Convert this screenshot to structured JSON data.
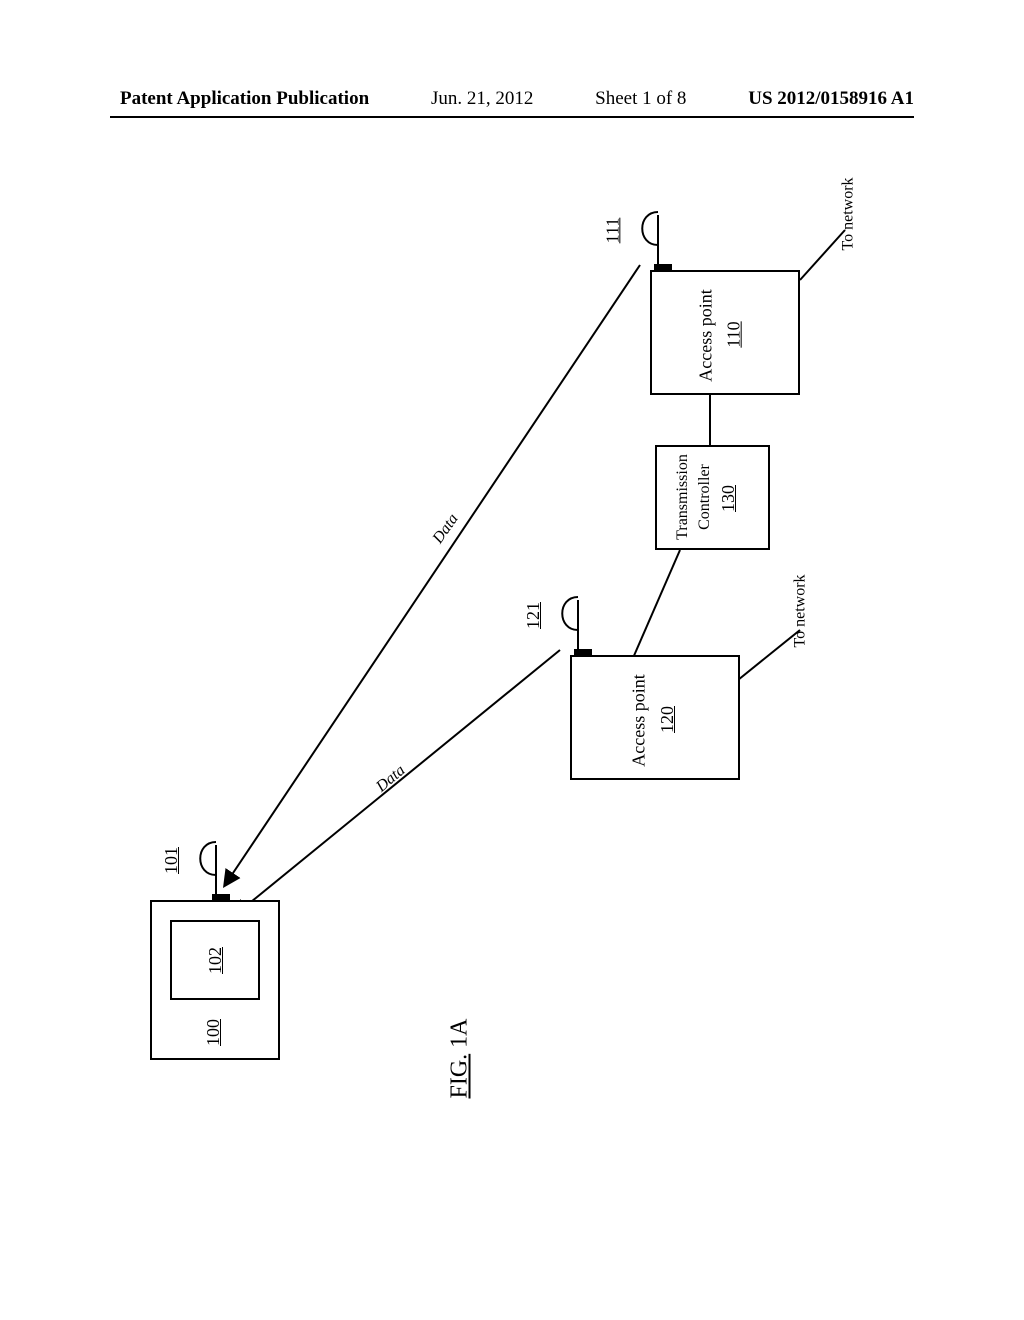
{
  "header": {
    "pub": "Patent Application Publication",
    "date": "Jun. 21, 2012",
    "sheet": "Sheet 1 of 8",
    "num": "US 2012/0158916 A1"
  },
  "diagram": {
    "device": {
      "ref_outer": "100",
      "ref_inner": "102",
      "antenna_ref": "101"
    },
    "ap1": {
      "label": "Access point",
      "ref": "110",
      "antenna_ref": "111",
      "net": "To network"
    },
    "ap2": {
      "label": "Access point",
      "ref": "120",
      "antenna_ref": "121",
      "net": "To network"
    },
    "ctrl": {
      "label_a": "Transmission",
      "label_b": "Controller",
      "ref": "130"
    },
    "link1": "Data",
    "link2": "Data",
    "figure_label": {
      "fig": "FIG.",
      "num": "1A"
    }
  }
}
